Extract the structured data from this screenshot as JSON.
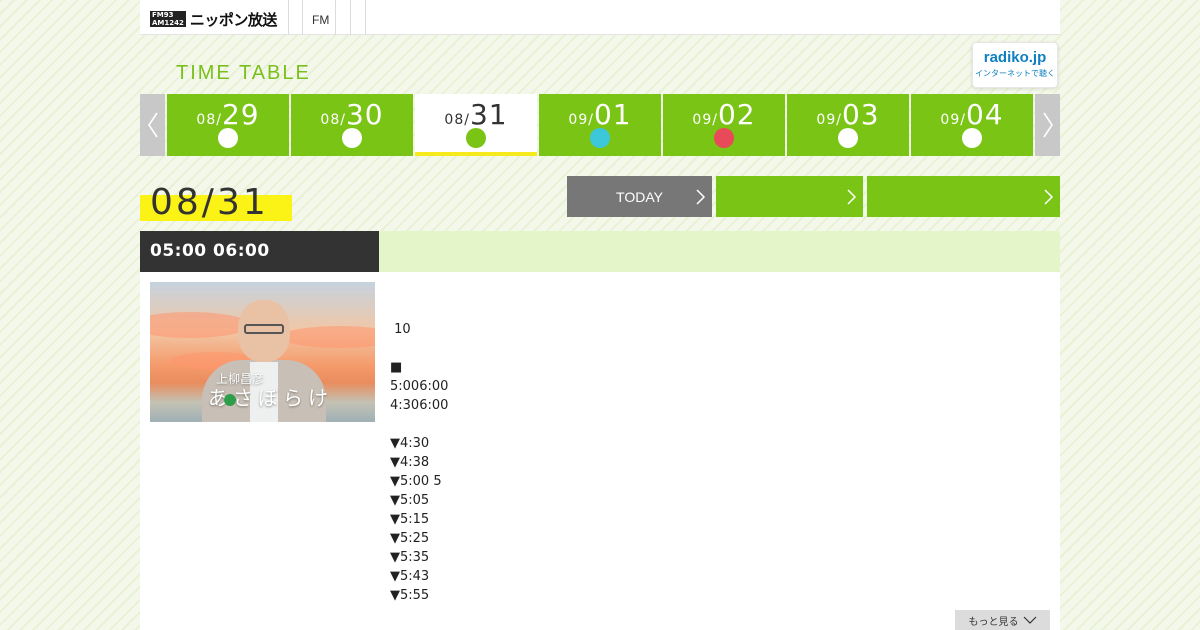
{
  "header": {
    "logo_badge_top": "FM93",
    "logo_badge_bottom": "AM1242",
    "logo_text": "ニッポン放送",
    "nav_fm": "FM"
  },
  "page_title": "TIME TABLE",
  "radiko": {
    "logo": "radiko.jp",
    "subtitle": "インターネットで聴く"
  },
  "date_tabs": [
    {
      "month": "08/",
      "day": "29",
      "dot_color": "#ffffff",
      "active": false
    },
    {
      "month": "08/",
      "day": "30",
      "dot_color": "#ffffff",
      "active": false
    },
    {
      "month": "08/",
      "day": "31",
      "dot_color": "#7ac415",
      "active": true
    },
    {
      "month": "09/",
      "day": "01",
      "dot_color": "#3cc8d8",
      "active": false
    },
    {
      "month": "09/",
      "day": "02",
      "dot_color": "#e84a5a",
      "active": false
    },
    {
      "month": "09/",
      "day": "03",
      "dot_color": "#ffffff",
      "active": false
    },
    {
      "month": "09/",
      "day": "04",
      "dot_color": "#ffffff",
      "active": false
    }
  ],
  "current_date": "08/31",
  "buttons": {
    "today": "TODAY",
    "btn2": "",
    "btn3": ""
  },
  "program": {
    "time": "05:00  06:00",
    "title": "",
    "thumb_title": "あさぼらけ",
    "thumb_subtitle": "上柳昌彦",
    "description_lines": [
      " 10",
      "",
      "■",
      "5:006:00",
      "4:306:00",
      "",
      "▼4:30",
      "▼4:38",
      "▼5:00 5",
      "▼5:05",
      "▼5:15",
      "▼5:25",
      "▼5:35",
      "▼5:43",
      "▼5:55"
    ],
    "more_label": "もっと見る"
  },
  "colors": {
    "accent_green": "#7ac415",
    "highlight_yellow": "#fbf315",
    "dark_header": "#333333",
    "today_button": "#777777"
  }
}
